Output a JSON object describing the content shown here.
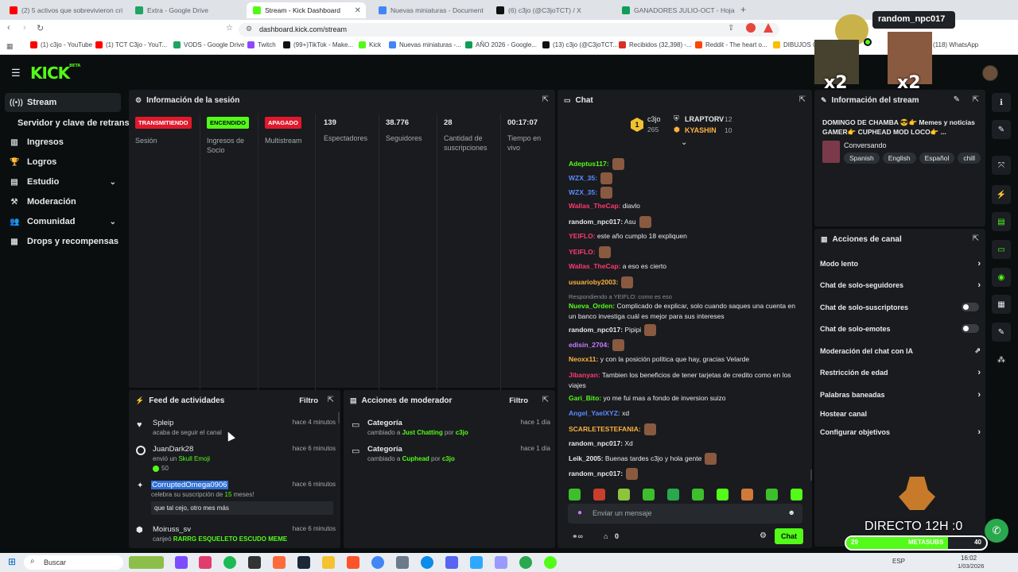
{
  "browser": {
    "tabs": [
      {
        "title": "(2) 5 activos que sobrevivieron crisis",
        "active": false
      },
      {
        "title": "Extra - Google Drive",
        "active": false
      },
      {
        "title": "Stream - Kick Dashboard",
        "active": true
      },
      {
        "title": "Nuevas miniaturas - Documentos de",
        "active": false
      },
      {
        "title": "(6) c3jo (@C3joTCT) / X",
        "active": false
      },
      {
        "title": "GANADORES JULIO-OCT - Hojas de",
        "active": false
      }
    ],
    "new_tab": "+",
    "url": "dashboard.kick.com/stream",
    "bookmarks": [
      "(1) c3jo - YouTube",
      "(1) TCT C3jo - YouT...",
      "VODS - Google Drive",
      "Twitch",
      "(99+)TikTok - Make...",
      "Kick",
      "Nuevas miniaturas -...",
      "AÑO 2026 - Google...",
      "(13) c3jo (@C3joTCT...",
      "Recibidos (32,398) -...",
      "Reddit - The heart o...",
      "DIBUJOS CE",
      "(118) WhatsApp"
    ]
  },
  "header": {
    "logo": "KICK",
    "logo_badge": "BETA"
  },
  "sidebar": {
    "items": [
      {
        "label": "Stream",
        "icon": "broadcast-icon"
      },
      {
        "label": "Servidor y clave de retransmisión"
      },
      {
        "label": "Ingresos",
        "icon": "chart-icon"
      },
      {
        "label": "Logros",
        "icon": "trophy-icon"
      },
      {
        "label": "Estudio",
        "icon": "layout-icon"
      },
      {
        "label": "Moderación",
        "icon": "hammer-icon"
      },
      {
        "label": "Comunidad",
        "icon": "users-icon"
      },
      {
        "label": "Drops y recompensas",
        "icon": "gift-icon"
      }
    ]
  },
  "session": {
    "title": "Información de la sesión",
    "stats": [
      {
        "value": "TRANSMITIENDO",
        "label": "Sesión",
        "badge": "#e0192c"
      },
      {
        "value": "ENCENDIDO",
        "label": "Ingresos de Socio",
        "badge": "#53fc18"
      },
      {
        "value": "APAGADO",
        "label": "Multistream",
        "badge": "#e0192c"
      },
      {
        "value": "139",
        "label": "Espectadores"
      },
      {
        "value": "38.776",
        "label": "Seguidores"
      },
      {
        "value": "28",
        "label": "Cantidad de suscripciones"
      },
      {
        "value": "00:17:07",
        "label": "Tiempo en vivo"
      }
    ]
  },
  "feed": {
    "title": "Feed de actividades",
    "filter": "Filtro",
    "items": [
      {
        "name": "Spleip",
        "sub": "acaba de seguir el canal",
        "time": "hace 4 minutos"
      },
      {
        "name": "JuanDark28",
        "sub_pre": "envió un ",
        "sub_hl": "Skull Emoji",
        "amount": "50",
        "time": "hace 6 minutos"
      },
      {
        "name": "CorruptedOmega0906",
        "sub_pre": "celebra su suscripción de ",
        "sub_hl": "15",
        "sub_post": " meses!",
        "message": "que tal cejo, otro mes más",
        "time": "hace 6 minutos"
      },
      {
        "name": "Moiruss_sv",
        "sub_pre": "canjeó ",
        "sub_hl": "RARRG ESQUELETO ESCUDO MEME",
        "time": "hace 6 minutos"
      }
    ]
  },
  "modactions": {
    "title": "Acciones de moderador",
    "filter": "Filtro",
    "items": [
      {
        "title": "Categoría",
        "pre": "cambiado a ",
        "target": "Just Chatting",
        "by": " por ",
        "user": "c3jo",
        "time": "hace 1 día"
      },
      {
        "title": "Categoría",
        "pre": "cambiado a ",
        "target": "Cuphead",
        "by": " por ",
        "user": "c3jo",
        "time": "hace 1 día"
      }
    ]
  },
  "chat": {
    "title": "Chat",
    "leaderboard": [
      {
        "rank": "1",
        "name": "c3jo",
        "score": "265"
      },
      {
        "name": "LRAPTORV",
        "score": "12"
      },
      {
        "name": "KYASHIN",
        "score": "10"
      }
    ],
    "messages": [
      {
        "user": "Adeptus117:",
        "color": "#53fc18",
        "text": "",
        "emote": true
      },
      {
        "user": "WZX_35:",
        "color": "#5b8cff",
        "text": "",
        "emote": true
      },
      {
        "user": "WZX_35:",
        "color": "#5b8cff",
        "text": "",
        "emote": true
      },
      {
        "user": "Wallas_TheCap:",
        "color": "#ff3a6e",
        "text": " diavlo"
      },
      {
        "user": "random_npc017:",
        "color": "#e8eaea",
        "text": " Asu",
        "emote": true
      },
      {
        "user": "YEIFLO:",
        "color": "#ff3a6e",
        "text": " este año cumplo 18 expliquen"
      },
      {
        "user": "YEIFLO:",
        "color": "#ff3a6e",
        "text": "",
        "emote": true
      },
      {
        "user": "Wallas_TheCap:",
        "color": "#ff3a6e",
        "text": " a eso es cierto"
      },
      {
        "user": "usuarioby2003:",
        "color": "#ffb23e",
        "text": "",
        "emote": true
      },
      {
        "reply": "Respondiendo a YEIFLO: como es eso"
      },
      {
        "user": "Nueva_Orden:",
        "color": "#53fc18",
        "text": " Complicado de explicar, solo cuando saques una cuenta en un banco investiga cuál es mejor para sus intereses"
      },
      {
        "user": "random_npc017:",
        "color": "#e8eaea",
        "text": " Pipipi",
        "emote": true
      },
      {
        "user": "edisin_2704:",
        "color": "#c77dff",
        "text": "",
        "emote": true
      },
      {
        "user": "Neoxx11:",
        "color": "#ffb23e",
        "text": " y con la posición política que hay, gracias Velarde"
      },
      {
        "user": "Jibanyan:",
        "color": "#ff3a6e",
        "text": " Tambien los beneficios de tener tarjetas de credito como en los viajes"
      },
      {
        "user": "Gari_Bito:",
        "color": "#53fc18",
        "text": " yo me fui mas a fondo de inversion suizo"
      },
      {
        "user": "Angel_YaelXYZ:",
        "color": "#5b8cff",
        "text": " xd"
      },
      {
        "user": "SCARLETESTEFANIA:",
        "color": "#ffb23e",
        "text": "",
        "emote": true
      },
      {
        "user": "random_npc017:",
        "color": "#e8eaea",
        "text": " Xd"
      },
      {
        "user": "Leik_2005:",
        "color": "#e8eaea",
        "text": " Buenas tardes c3jo y hola gente",
        "emote": true
      },
      {
        "user": "random_npc017:",
        "color": "#e8eaea",
        "text": "",
        "emote": true
      }
    ],
    "input_placeholder": "Enviar un mensaje",
    "send_label": "Chat",
    "points": "0"
  },
  "stream_info": {
    "title": "Información del stream",
    "stream_title": "DOMINGO DE CHAMBA 😎👉 Memes y noticias GAMER👉 CUPHEAD MOD LOCO👉 ...",
    "category": "Conversando",
    "tags": [
      "Spanish",
      "English",
      "Español",
      "chill"
    ]
  },
  "channel_actions": {
    "title": "Acciones de canal",
    "items": [
      {
        "label": "Modo lento",
        "type": "arrow"
      },
      {
        "label": "Chat de solo-seguidores",
        "type": "arrow"
      },
      {
        "label": "Chat de solo-suscriptores",
        "type": "toggle"
      },
      {
        "label": "Chat de solo-emotes",
        "type": "toggle"
      },
      {
        "label": "Moderación del chat con IA",
        "type": "link"
      },
      {
        "label": "Restricción de edad",
        "type": "arrow"
      },
      {
        "label": "Palabras baneadas",
        "type": "arrow"
      },
      {
        "label": "Hostear canal",
        "type": "none"
      },
      {
        "label": "Configurar objetivos",
        "type": "arrow"
      }
    ]
  },
  "overlay": {
    "username": "random_npc017",
    "multiplier": "x2",
    "live_label": "DIRECTO 12H :0",
    "goal_label": "METASUBS",
    "goal_left": "29",
    "goal_right": "40",
    "goal_fraction": 0.725
  },
  "taskbar": {
    "search": "Buscar",
    "lang": "ESP",
    "time": "16:02",
    "date": "1/03/2026"
  },
  "colors": {
    "accent": "#53fc18",
    "live": "#e0192c",
    "panel": "#191b1f",
    "bg": "#0b0e0f"
  }
}
